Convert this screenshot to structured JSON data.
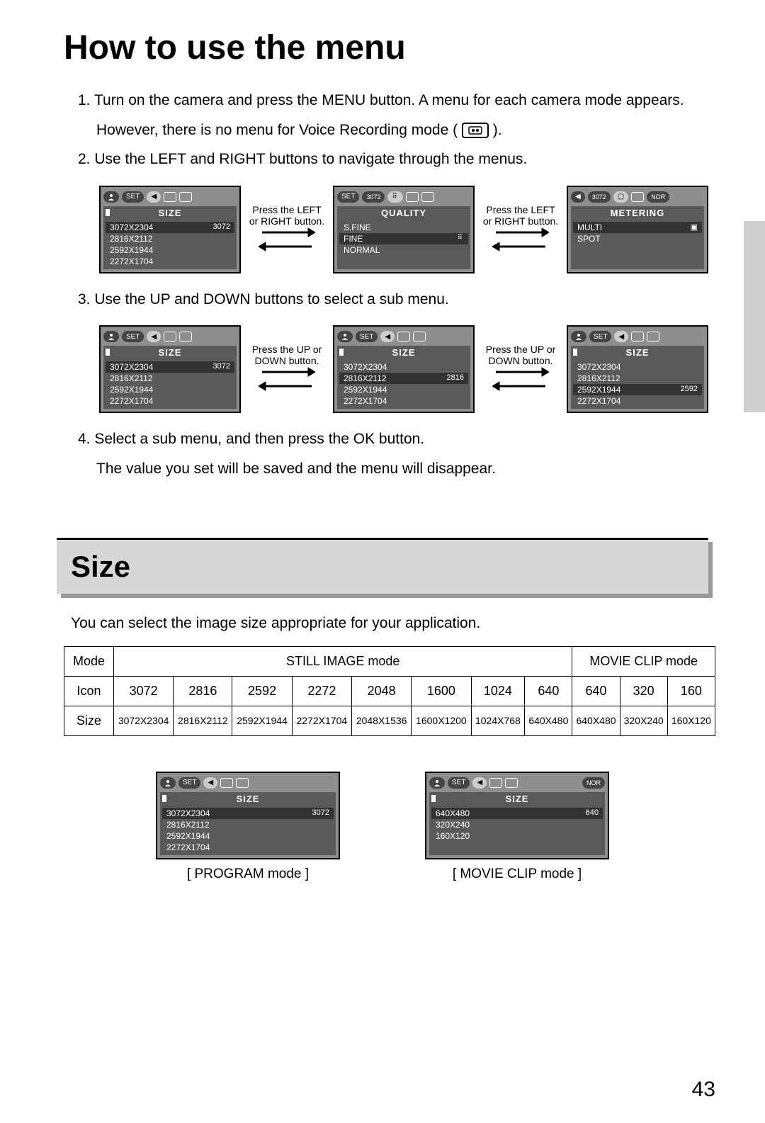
{
  "page_title": "How to use the menu",
  "steps": {
    "s1a": "1. Turn on the camera and press the MENU button. A menu for each camera mode appears.",
    "s1b": "However, there is no menu for Voice Recording mode (",
    "s1c": ").",
    "s2": "2. Use the LEFT and RIGHT buttons to navigate through the menus.",
    "s3": "3. Use the UP and DOWN buttons to select a sub menu.",
    "s4a": "4. Select a sub menu, and then press the OK button.",
    "s4b": "The value you set will be saved and the menu will disappear."
  },
  "labels": {
    "press_lr": "Press the LEFT or RIGHT button.",
    "press_ud": "Press the UP or DOWN button.",
    "set": "SET",
    "nor": "NOR"
  },
  "screens": {
    "size_tag": "3072",
    "size_title": "SIZE",
    "size_items": [
      "3072X2304",
      "2816X2112",
      "2592X1944",
      "2272X1704"
    ],
    "quality_title": "QUALITY",
    "quality_tag": "3072",
    "quality_items": [
      "S.FINE",
      "FINE",
      "NORMAL"
    ],
    "metering_title": "METERING",
    "metering_tag": "3072",
    "metering_items": [
      "MULTI",
      "SPOT"
    ],
    "size_sel0_val": "3072",
    "size_sel1_val": "2816",
    "size_sel2_val": "2592",
    "movie_title": "SIZE",
    "movie_items": [
      "640X480",
      "320X240",
      "160X120"
    ],
    "movie_sel_val": "640",
    "program_caption": "[ PROGRAM mode ]",
    "movie_caption": "[ MOVIE CLIP mode ]"
  },
  "section": {
    "title": "Size",
    "intro": "You can select the image size appropriate for your application."
  },
  "table": {
    "head_mode": "Mode",
    "head_icon": "Icon",
    "head_size": "Size",
    "still_label": "STILL IMAGE mode",
    "movie_label": "MOVIE CLIP mode",
    "icons": [
      "3072",
      "2816",
      "2592",
      "2272",
      "2048",
      "1600",
      "1024",
      "640",
      "640",
      "320",
      "160"
    ],
    "sizes": [
      "3072X2304",
      "2816X2112",
      "2592X1944",
      "2272X1704",
      "2048X1536",
      "1600X1200",
      "1024X768",
      "640X480",
      "640X480",
      "320X240",
      "160X120"
    ]
  },
  "page_number": "43"
}
